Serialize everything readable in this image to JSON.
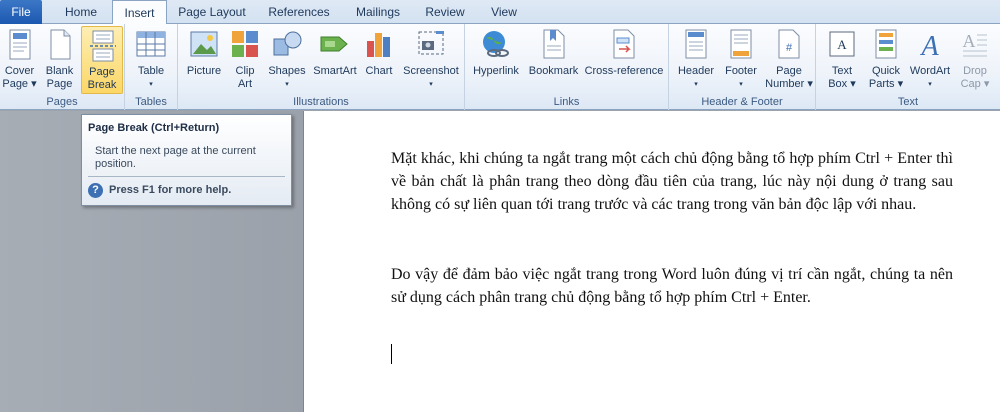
{
  "tabs": {
    "file": "File",
    "home": "Home",
    "insert": "Insert",
    "page_layout": "Page Layout",
    "references": "References",
    "mailings": "Mailings",
    "review": "Review",
    "view": "View",
    "active": "Insert"
  },
  "ribbon": {
    "pages": {
      "label": "Pages",
      "cover_page": [
        "Cover",
        "Page ▾"
      ],
      "blank_page": [
        "Blank",
        "Page"
      ],
      "page_break": [
        "Page",
        "Break"
      ]
    },
    "tables": {
      "label": "Tables",
      "table": [
        "Table",
        "▾"
      ]
    },
    "illustrations": {
      "label": "Illustrations",
      "picture": "Picture",
      "clip_art": [
        "Clip",
        "Art"
      ],
      "shapes": [
        "Shapes",
        "▾"
      ],
      "smartart": "SmartArt",
      "chart": "Chart",
      "screenshot": [
        "Screenshot",
        "▾"
      ]
    },
    "links": {
      "label": "Links",
      "hyperlink": "Hyperlink",
      "bookmark": "Bookmark",
      "cross_reference": "Cross-reference"
    },
    "header_footer": {
      "label": "Header & Footer",
      "header": [
        "Header",
        "▾"
      ],
      "footer": [
        "Footer",
        "▾"
      ],
      "page_number": [
        "Page",
        "Number ▾"
      ]
    },
    "text": {
      "label": "Text",
      "text_box": [
        "Text",
        "Box ▾"
      ],
      "quick_parts": [
        "Quick",
        "Parts ▾"
      ],
      "wordart": [
        "WordArt",
        "▾"
      ],
      "drop_cap": [
        "Drop",
        "Cap ▾"
      ]
    }
  },
  "tooltip": {
    "title": "Page Break (Ctrl+Return)",
    "description": "Start the next page at the current position.",
    "help": "Press F1 for more help."
  },
  "document": {
    "paragraph1": "Mặt khác, khi chúng ta ngắt trang một cách chủ động bằng tổ hợp phím Ctrl + Enter thì về bản chất là phân trang theo dòng đầu tiên của trang, lúc này nội dung ở trang sau không có sự liên quan tới trang trước và các trang trong văn bản độc lập với nhau.",
    "paragraph2": "Do vậy để đảm bảo việc ngắt trang trong Word luôn đúng vị trí cần ngắt, chúng ta nên sử dụng cách phân trang chủ động bằng tổ hợp phím Ctrl + Enter."
  },
  "colors": {
    "ribbon_bg": "#eef3fa",
    "file_tab": "#2a66bb",
    "hover": "#fcd767"
  }
}
